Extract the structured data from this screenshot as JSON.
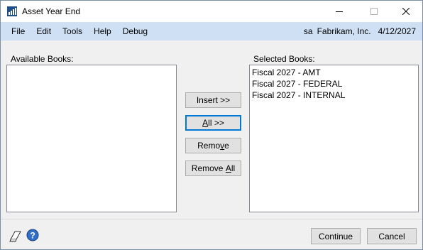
{
  "window": {
    "title": "Asset Year End",
    "icon": "bar-chart-app-icon",
    "controls": [
      "minimize-icon",
      "maximize-icon",
      "close-icon"
    ]
  },
  "menu": {
    "items": [
      "File",
      "Edit",
      "Tools",
      "Help",
      "Debug"
    ],
    "user": "sa",
    "company": "Fabrikam, Inc.",
    "date": "4/12/2027"
  },
  "available": {
    "label": "Available Books:",
    "items": []
  },
  "selected": {
    "label": "Selected Books:",
    "items": [
      "Fiscal 2027 - AMT",
      "Fiscal 2027 - FEDERAL",
      "Fiscal 2027 - INTERNAL"
    ]
  },
  "buttons": {
    "insert": {
      "pre": "Insert >>",
      "acc": "",
      "post": ""
    },
    "all": {
      "pre": "",
      "acc": "A",
      "post": "ll >>"
    },
    "remove": {
      "pre": "Remo",
      "acc": "v",
      "post": "e"
    },
    "remove_all": {
      "pre": "Remove ",
      "acc": "A",
      "post": "ll"
    },
    "continue": "Continue",
    "cancel": "Cancel"
  },
  "footer_icons": [
    "note-icon",
    "help-icon"
  ],
  "colors": {
    "menu_bg": "#cfe0f5",
    "accent": "#0078d7",
    "window_bg": "#f0f0f0"
  }
}
